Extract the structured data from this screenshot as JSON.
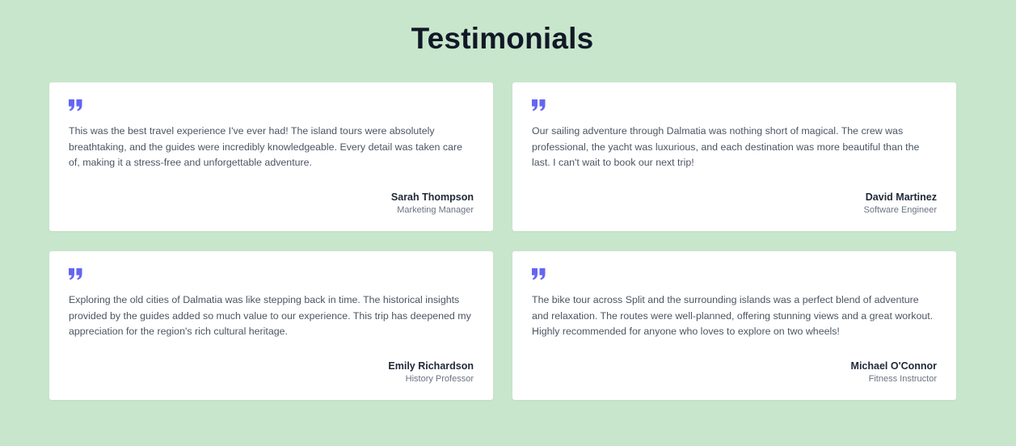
{
  "page": {
    "title": "Testimonials",
    "background_color": "#c8e6cb",
    "accent_color": "#6366f1"
  },
  "testimonials": [
    {
      "quote": "This was the best travel experience I've ever had! The island tours were absolutely breathtaking, and the guides were incredibly knowledgeable. Every detail was taken care of, making it a stress-free and unforgettable adventure.",
      "name": "Sarah Thompson",
      "role": "Marketing Manager",
      "icon": "quote-icon"
    },
    {
      "quote": "Our sailing adventure through Dalmatia was nothing short of magical. The crew was professional, the yacht was luxurious, and each destination was more beautiful than the last. I can't wait to book our next trip!",
      "name": "David Martinez",
      "role": "Software Engineer",
      "icon": "quote-icon"
    },
    {
      "quote": "Exploring the old cities of Dalmatia was like stepping back in time. The historical insights provided by the guides added so much value to our experience. This trip has deepened my appreciation for the region's rich cultural heritage.",
      "name": "Emily Richardson",
      "role": "History Professor",
      "icon": "quote-icon"
    },
    {
      "quote": "The bike tour across Split and the surrounding islands was a perfect blend of adventure and relaxation. The routes were well-planned, offering stunning views and a great workout. Highly recommended for anyone who loves to explore on two wheels!",
      "name": "Michael O'Connor",
      "role": "Fitness Instructor",
      "icon": "quote-icon"
    }
  ]
}
